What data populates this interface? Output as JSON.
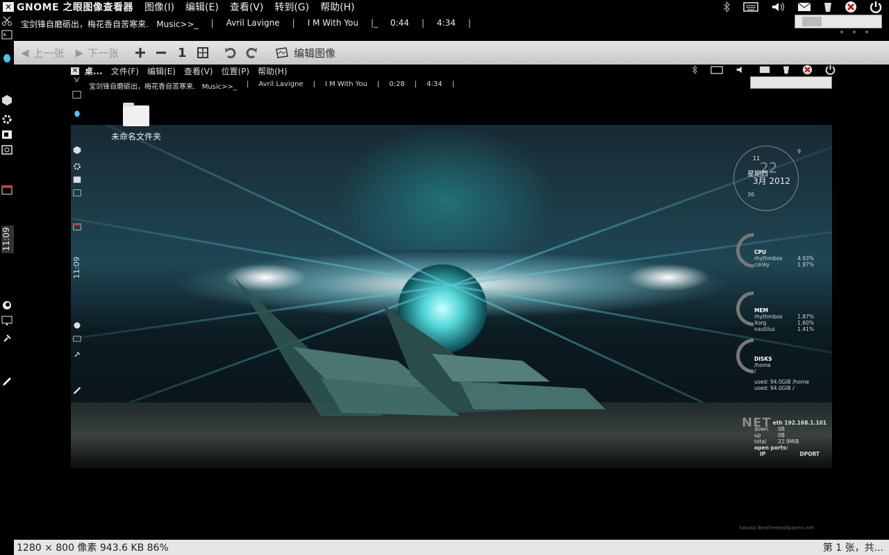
{
  "topbar": {
    "app_title": "GNOME 之眼图像查看器",
    "menus": [
      "图像(I)",
      "编辑(E)",
      "查看(V)",
      "转到(G)",
      "帮助(H)"
    ]
  },
  "music": {
    "quote": "宝剑锋自磨砺出，梅花香自苦寒来.   Music>>_",
    "artist": "Avril Lavigne",
    "track": "I M With You",
    "elapsed": "0:44",
    "total": "4:34"
  },
  "left_panel": {
    "clock": "11:09"
  },
  "toolbar": {
    "prev": "上一张",
    "next": "下一张",
    "zoom_normal": "1",
    "edit": "编辑图像"
  },
  "inner": {
    "app_title": "桌...",
    "menus": [
      "文件(F)",
      "编辑(E)",
      "查看(V)",
      "位置(P)",
      "帮助(H)"
    ],
    "music": {
      "quote": "宝剑锋自磨砺出，梅花香自苦寒来.   Music>>_",
      "artist": "Avril Lavigne",
      "track": "I M With You",
      "elapsed": "0:28",
      "total": "4:34"
    },
    "clock": "11:09",
    "folder_label": "未命名文件夹"
  },
  "conky": {
    "date": {
      "day": "22",
      "weekday": "星期四",
      "monthyear": "3月 2012",
      "n11": "11",
      "n9": "9",
      "n36": "36"
    },
    "cpu": {
      "header": "CPU",
      "rows": [
        [
          "rhythmbox",
          "4.93%"
        ],
        [
          "",
          ""
        ],
        [
          "conky",
          "1.97%"
        ]
      ]
    },
    "mem": {
      "header": "MEM",
      "rows": [
        [
          "rhythmbox",
          "1.87%"
        ],
        [
          "Xorg",
          "1.60%"
        ],
        [
          "nautilus",
          "1.41%"
        ]
      ]
    },
    "disks": {
      "header": "DISKS",
      "path": "/home",
      "root": "/",
      "used_home": "used: 94.0GiB /home",
      "used_root": "used: 94.0GiB /"
    },
    "net": {
      "big": "NET",
      "eth": "eth 192.168.1.101",
      "down_label": "down",
      "down": "0B",
      "up_label": "up",
      "up": "0B",
      "total_label": "total",
      "total": "22.9MiB",
      "open_ports": "open ports:",
      "ip": "IP",
      "dport": "DPORT"
    },
    "watermark": "Sakasa Bestfreewallpapers.net"
  },
  "status": {
    "info": "1280 × 800 像素  943.6 KB   86%",
    "position": "第 1 张，共..."
  },
  "colors": {
    "accent": "#4fd6d6",
    "toolbar_bg": "#d8d8d8",
    "statusbar_bg": "#e6e6e6"
  }
}
